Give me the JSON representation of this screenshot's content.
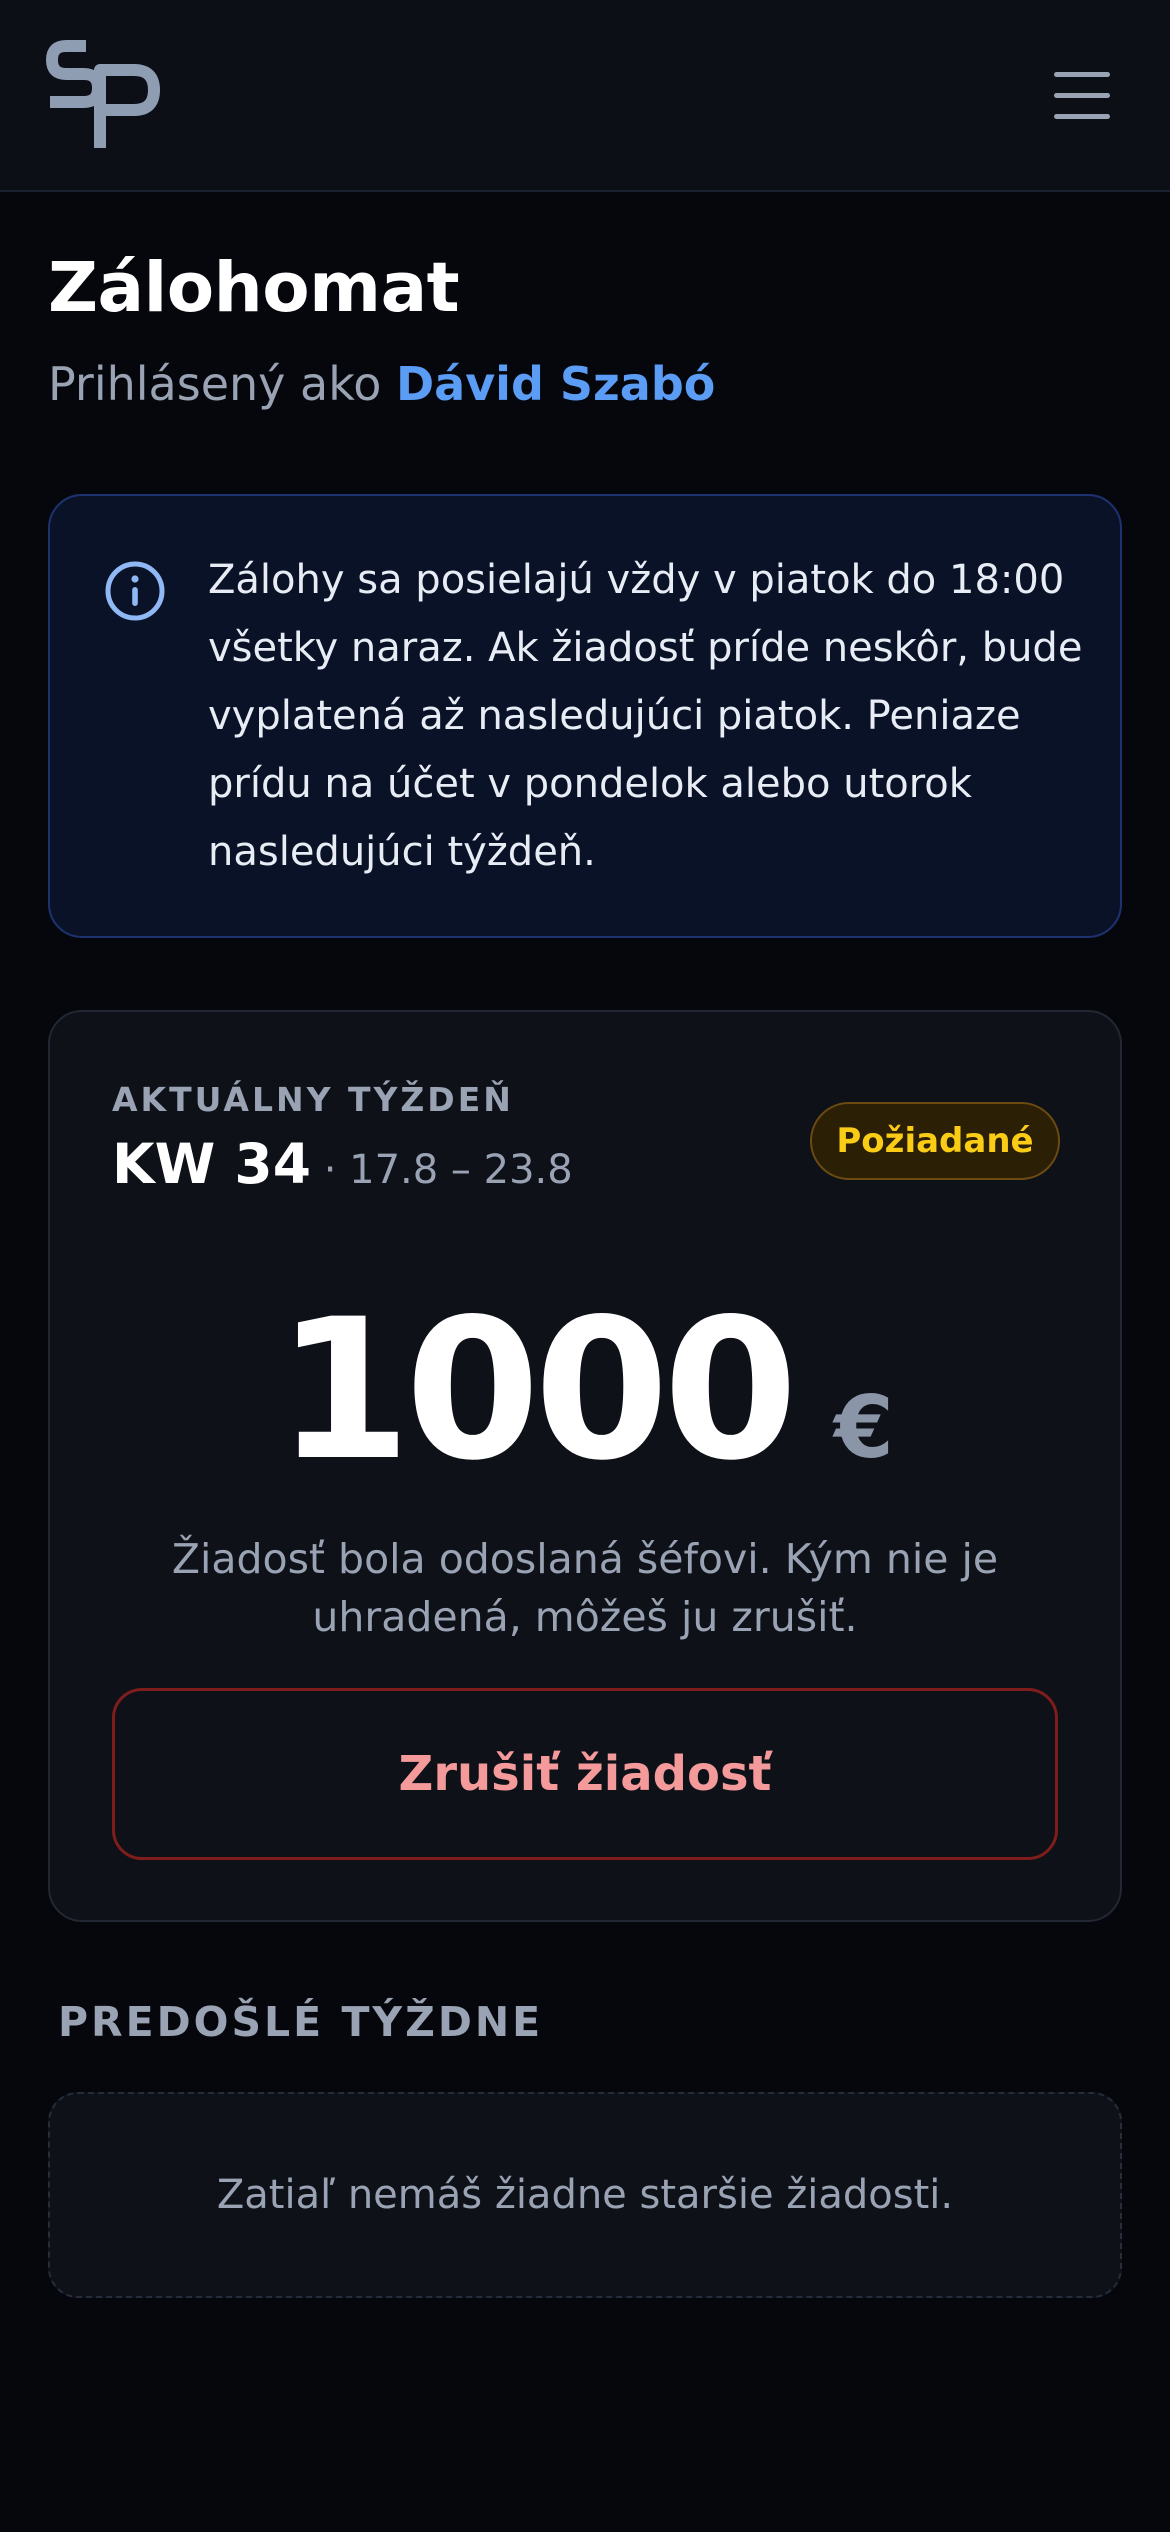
{
  "header": {
    "logo_icon": "sp-logo-icon",
    "menu_icon": "hamburger-menu-icon"
  },
  "page": {
    "title": "Zálohomat",
    "subtitle_prefix": "Prihlásený ako ",
    "user_name": "Dávid Szabó"
  },
  "info": {
    "icon": "info-icon",
    "text": "Zálohy sa posielajú vždy v piatok do 18:00 všetky naraz. Ak žiadosť príde neskôr, bude vyplatená až nasledujúci piatok. Peniaze prídu na účet v pondelok alebo utorok nasledujúci týždeň."
  },
  "current_week": {
    "label": "AKTUÁLNY TÝŽDEŇ",
    "week": "KW 34",
    "separator": " · ",
    "range": "17.8 – 23.8",
    "status": "Požiadané",
    "amount": "1000",
    "currency": "€",
    "note": "Žiadosť bola odoslaná šéfovi. Kým nie je uhradená, môžeš ju zrušiť.",
    "cancel_label": "Zrušiť žiadosť"
  },
  "previous_weeks": {
    "title": "PREDOŠLÉ TÝŽDNE",
    "empty_text": "Zatiaľ nemáš žiadne staršie žiadosti."
  },
  "colors": {
    "background": "#05070d",
    "accent_blue": "#5b9cf5",
    "status_yellow": "#facc15",
    "danger_red": "#f49a9a"
  }
}
